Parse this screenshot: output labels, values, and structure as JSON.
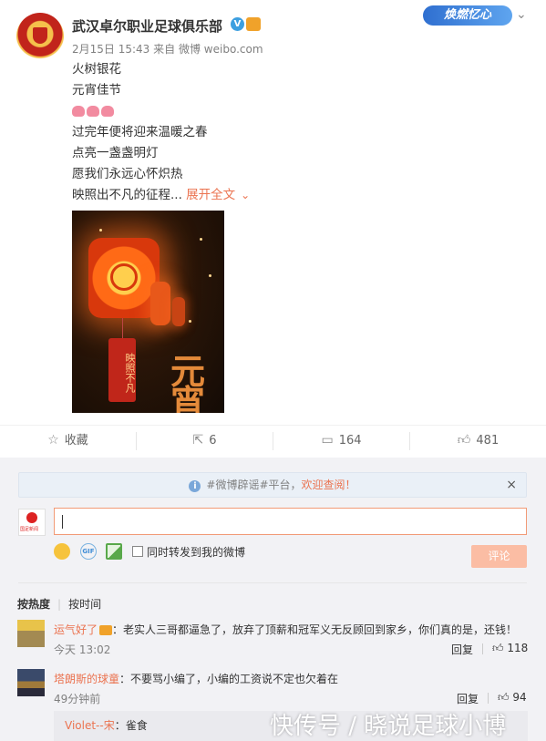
{
  "post": {
    "username": "武汉卓尔职业足球俱乐部",
    "badge_verified": "V",
    "brand_badge": "焕燃忆心",
    "time": "2月15日 15:43",
    "source_prefix": "来自",
    "source": "微博 weibo.com",
    "lines": [
      "火树银花",
      "元宵佳节",
      "过完年便将迎来温暖之春",
      "点亮一盏盏明灯",
      "愿我们永远心怀炽热"
    ],
    "last_line": "映照出不凡的征程...",
    "expand_label": "展开全文",
    "image": {
      "tag_text": "映照不凡",
      "calligraphy": "元宵"
    }
  },
  "actions": {
    "favorite_label": "收藏",
    "repost_count": "6",
    "comment_count": "164",
    "like_count": "481"
  },
  "comments_panel": {
    "notice_pre": "#微博辟谣#平台，",
    "notice_highlight": "欢迎查阅！",
    "close": "×",
    "sync_label": "同时转发到我的微博",
    "submit_label": "评论",
    "sort_hot": "按热度",
    "sort_time": "按时间",
    "me_avatar_text": "国足新闻"
  },
  "comments": [
    {
      "name": "运气好了",
      "text": "：老实人三哥都逼急了，放弃了顶薪和冠军义无反顾回到家乡，你们真的是，还钱！",
      "time": "今天 13:02",
      "reply": "回复",
      "likes": "118"
    },
    {
      "name": "塔朗斯的球童",
      "text": "：不要骂小编了，小编的工资说不定也欠着在",
      "time": "49分钟前",
      "reply": "回复",
      "likes": "94"
    }
  ],
  "sub_reply": {
    "name": "Violet--宋",
    "text": "：雀食"
  },
  "watermark": "快传号 / 晓说足球小博",
  "colors": {
    "accent": "#eb7350",
    "verified": "#3c9fe0",
    "background": "#f2f2f5"
  }
}
